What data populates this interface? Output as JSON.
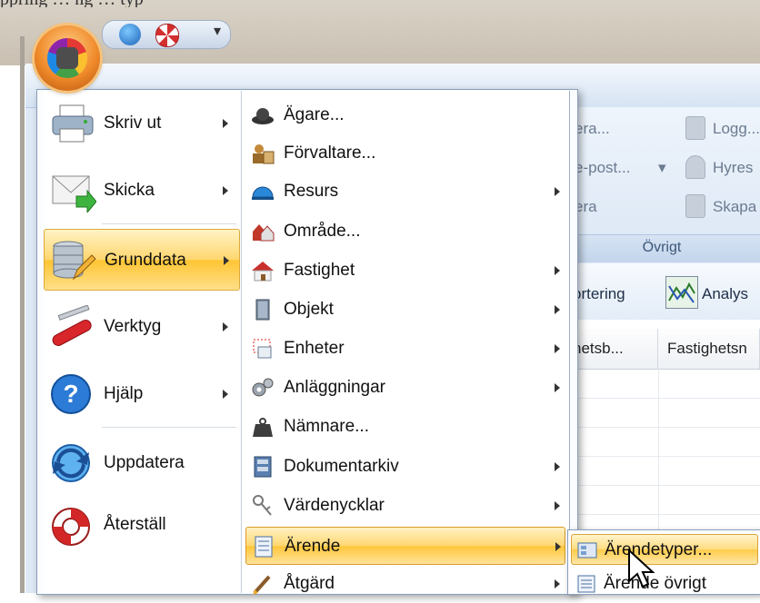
{
  "top_clip_text": "ppring … ng … typ",
  "quick_access": {
    "items": [
      {
        "icon": "refresh-globe-icon"
      },
      {
        "icon": "lifebuoy-icon"
      }
    ],
    "dropdown": "▾"
  },
  "ribbon": {
    "items": [
      {
        "label": "era..."
      },
      {
        "label": "e-post..."
      },
      {
        "label": "era"
      },
      {
        "label": "Logg..."
      },
      {
        "label": "Hyres"
      },
      {
        "label": "Skapa"
      }
    ],
    "group_label": "Övrigt",
    "subtool_left": "ortering",
    "subtool_right": "Analys"
  },
  "grid": {
    "columns": [
      "hetsb...",
      "Fastighetsn"
    ]
  },
  "app_menu": {
    "left_items": [
      {
        "label": "Skriv ut",
        "icon": "printer-icon",
        "has_arrow": true
      },
      {
        "label": "Skicka",
        "icon": "envelope-send-icon",
        "has_arrow": true
      },
      {
        "label": "Grunddata",
        "icon": "database-edit-icon",
        "has_arrow": true,
        "selected": true
      },
      {
        "label": "Verktyg",
        "icon": "tools-icon",
        "has_arrow": true
      },
      {
        "label": "Hjälp",
        "icon": "help-icon",
        "has_arrow": true
      },
      {
        "label": "Uppdatera",
        "icon": "refresh-globe-icon",
        "has_arrow": false
      },
      {
        "label": "Återställ",
        "icon": "lifebuoy-icon",
        "has_arrow": false
      }
    ],
    "submenu_items": [
      {
        "label": "Ägare...",
        "icon": "hat-icon",
        "has_arrow": false
      },
      {
        "label": "Förvaltare...",
        "icon": "manager-icon",
        "has_arrow": false
      },
      {
        "label": "Resurs",
        "icon": "helmet-icon",
        "has_arrow": true
      },
      {
        "label": "Område...",
        "icon": "houses-icon",
        "has_arrow": false
      },
      {
        "label": "Fastighet",
        "icon": "house-icon",
        "has_arrow": true
      },
      {
        "label": "Objekt",
        "icon": "door-icon",
        "has_arrow": true
      },
      {
        "label": "Enheter",
        "icon": "units-icon",
        "has_arrow": true
      },
      {
        "label": "Anläggningar",
        "icon": "gears-icon",
        "has_arrow": true
      },
      {
        "label": "Nämnare...",
        "icon": "weight-icon",
        "has_arrow": false
      },
      {
        "label": "Dokumentarkiv",
        "icon": "archive-icon",
        "has_arrow": true
      },
      {
        "label": "Värdenycklar",
        "icon": "keys-icon",
        "has_arrow": true
      },
      {
        "label": "Ärende",
        "icon": "form-icon",
        "has_arrow": true,
        "selected": true
      },
      {
        "label": "Åtgärd",
        "icon": "brush-icon",
        "has_arrow": true
      }
    ],
    "flyout_items": [
      {
        "label": "Ärendetyper...",
        "icon": "list-types-icon",
        "selected": true
      },
      {
        "label": "Ärende övrigt",
        "icon": "form-icon"
      }
    ]
  }
}
